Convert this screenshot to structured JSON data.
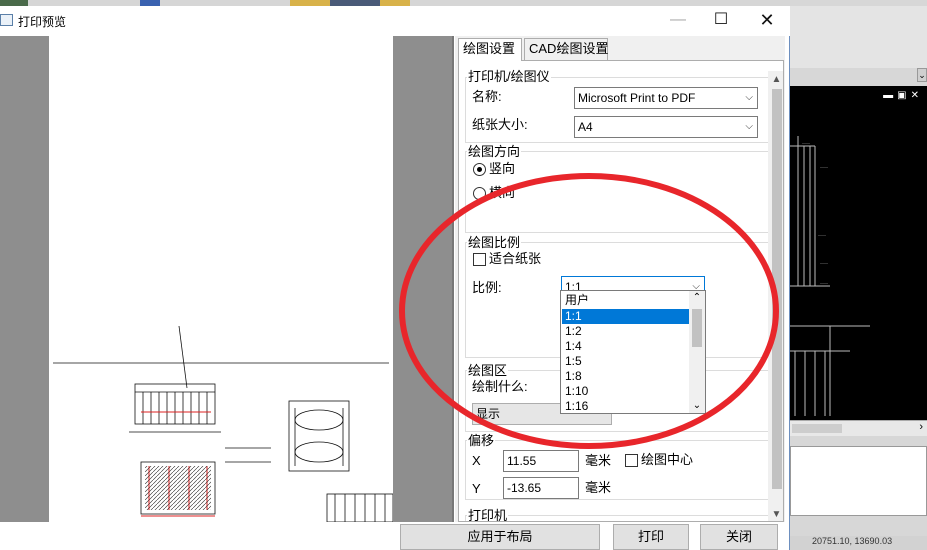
{
  "window": {
    "title": "打印预览",
    "min_glyph": "—",
    "max_glyph": "☐",
    "close_glyph": "✕"
  },
  "tabs": [
    {
      "label": "绘图设置"
    },
    {
      "label": "CAD绘图设置"
    }
  ],
  "printer_group": {
    "title": "打印机/绘图仪",
    "name_label": "名称:",
    "name_value": "Microsoft Print to PDF",
    "paper_label": "纸张大小:",
    "paper_value": "A4"
  },
  "orientation_group": {
    "title": "绘图方向",
    "portrait_label": "竖向",
    "landscape_label": "横向",
    "selected": "竖向"
  },
  "scale_group": {
    "title": "绘图比例",
    "fit_label": "适合纸张",
    "fit_checked": false,
    "scale_label": "比例:",
    "scale_value": "1:1",
    "options": [
      "用户",
      "1:1",
      "1:2",
      "1:4",
      "1:5",
      "1:8",
      "1:10",
      "1:16"
    ],
    "selected_option": "1:1"
  },
  "area_group": {
    "title": "绘图区",
    "what_label": "绘制什么:",
    "what_value": "显示"
  },
  "offset_group": {
    "title": "偏移",
    "x_label": "X",
    "x_value": "11.55",
    "x_unit": "毫米",
    "center_label": "绘图中心",
    "center_checked": false,
    "y_label": "Y",
    "y_value": "-13.65",
    "y_unit": "毫米"
  },
  "printer_section": {
    "title": "打印机"
  },
  "buttons": {
    "apply_layout": "应用于布局",
    "print": "打印",
    "close": "关闭"
  },
  "icons": {
    "chevron": "chevron-down-icon",
    "scroll_up": "scroll-up-icon",
    "scroll_down": "scroll-down-icon"
  },
  "colors": {
    "selection": "#0078d7",
    "annotation": "#e8262b",
    "preview_bg": "#8e8e8e",
    "cad_bg": "#000000"
  },
  "background_app": {
    "status_text": "20751.10, 13690.03"
  }
}
